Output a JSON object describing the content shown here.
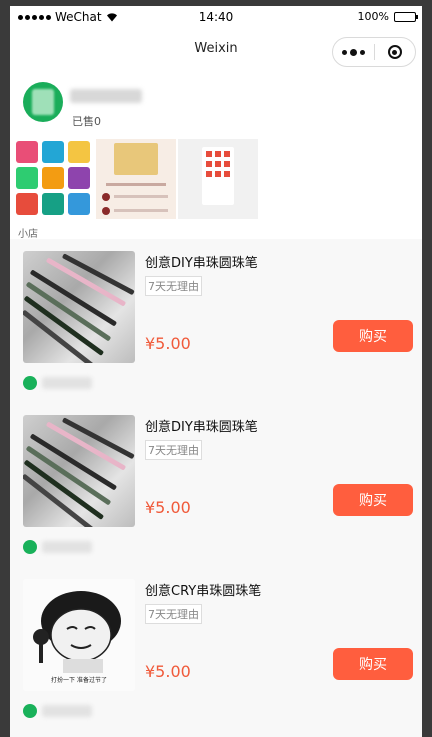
{
  "status_bar": {
    "carrier": "WeChat",
    "time": "14:40",
    "battery": "100%",
    "battery_level": 1.0
  },
  "nav": {
    "title": "Weixin"
  },
  "shop": {
    "sold_label": "已售0",
    "section_label": "小店"
  },
  "products": [
    {
      "title": "创意DIY串珠圆珠笔",
      "tag": "7天无理由",
      "price": "¥5.00",
      "buy_label": "购买"
    },
    {
      "title": "创意DIY串珠圆珠笔",
      "tag": "7天无理由",
      "price": "¥5.00",
      "buy_label": "购买"
    },
    {
      "title": "创意CRY串珠圆珠笔",
      "tag": "7天无理由",
      "price": "¥5.00",
      "buy_label": "购买"
    }
  ],
  "meme_caption": "打扮一下 准备过节了",
  "colors": {
    "accent_green": "#1aad5a",
    "buy_button": "#ff5e3e",
    "price": "#f05a3a"
  }
}
